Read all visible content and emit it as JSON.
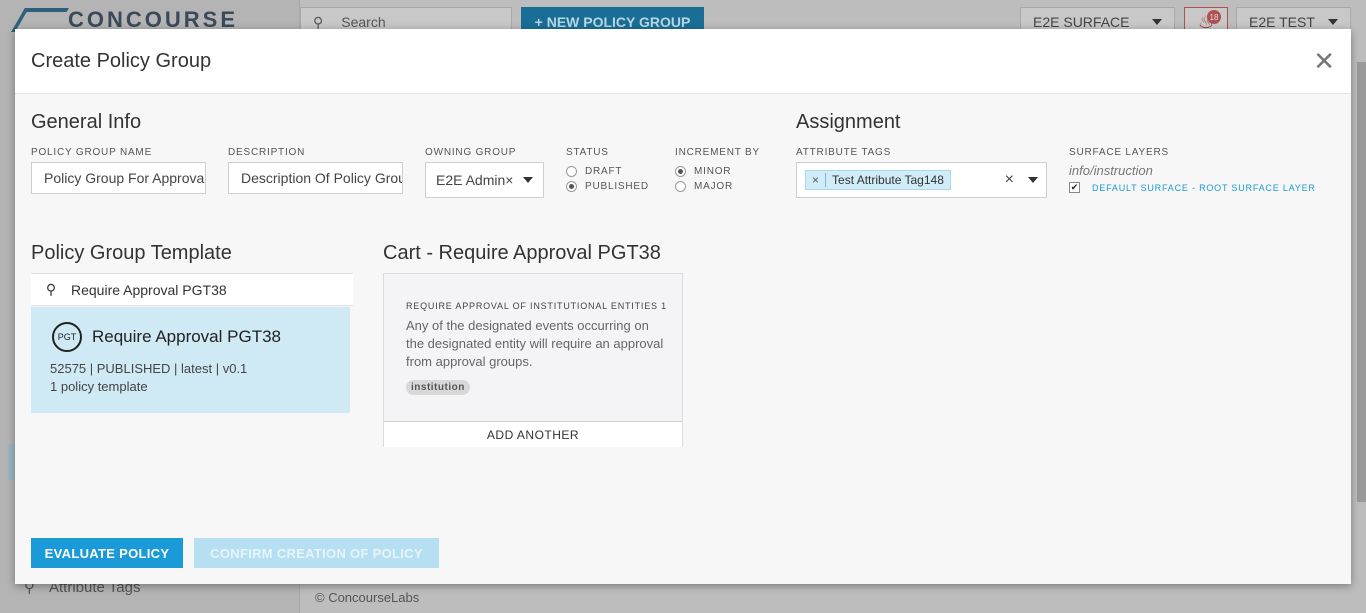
{
  "background": {
    "logo_text": "CONCOURSE",
    "search_placeholder": "Search",
    "new_policy_group_label": "+ NEW POLICY GROUP",
    "surface_select": "E2E SURFACE",
    "notification_count": "18",
    "user_select": "E2E TEST",
    "sidebar_item": "Attribute Tags",
    "footer": "© ConcourseLabs"
  },
  "modal": {
    "title": "Create Policy Group",
    "close_icon": "close-icon"
  },
  "general_info": {
    "title": "General Info",
    "name_label": "POLICY GROUP NAME",
    "name_value": "Policy Group For Approval",
    "description_label": "DESCRIPTION",
    "description_value": "Description Of Policy Group",
    "owning_group_label": "OWNING GROUP",
    "owning_group_value": "E2E Admin",
    "status_label": "STATUS",
    "status_options": [
      "DRAFT",
      "PUBLISHED"
    ],
    "status_selected": "PUBLISHED",
    "increment_label": "INCREMENT BY",
    "increment_options": [
      "MINOR",
      "MAJOR"
    ],
    "increment_selected": "MINOR"
  },
  "assignment": {
    "title": "Assignment",
    "attribute_tags_label": "ATTRIBUTE TAGS",
    "attribute_tag": "Test Attribute Tag148",
    "surface_layers_label": "SURFACE LAYERS",
    "surface_layers_hint": "info/instruction",
    "surface_layer_option": "DEFAULT SURFACE - ROOT SURFACE LAYER",
    "surface_layer_checked": true
  },
  "template": {
    "title": "Policy Group Template",
    "search_value": "Require Approval PGT38",
    "card_icon_text": "PGT",
    "card_name": "Require Approval PGT38",
    "card_meta_line1": "52575 | PUBLISHED | latest | v0.1",
    "card_meta_line2": "1 policy template"
  },
  "cart": {
    "title": "Cart - Require Approval PGT38",
    "item_kicker": "REQUIRE APPROVAL OF INSTITUTIONAL ENTITIES 1",
    "item_description": "Any of the designated events occurring on the designated entity will require an approval from approval groups.",
    "item_tag": "institution",
    "add_another_label": "ADD ANOTHER"
  },
  "footer_buttons": {
    "evaluate_label": "EVALUATE POLICY",
    "confirm_label": "CONFIRM CREATION OF POLICY"
  },
  "colors": {
    "primary": "#1a9ad6",
    "primary_disabled": "#b6dff1",
    "selected_card": "#cfe9f5",
    "link": "#1a9ad6"
  }
}
